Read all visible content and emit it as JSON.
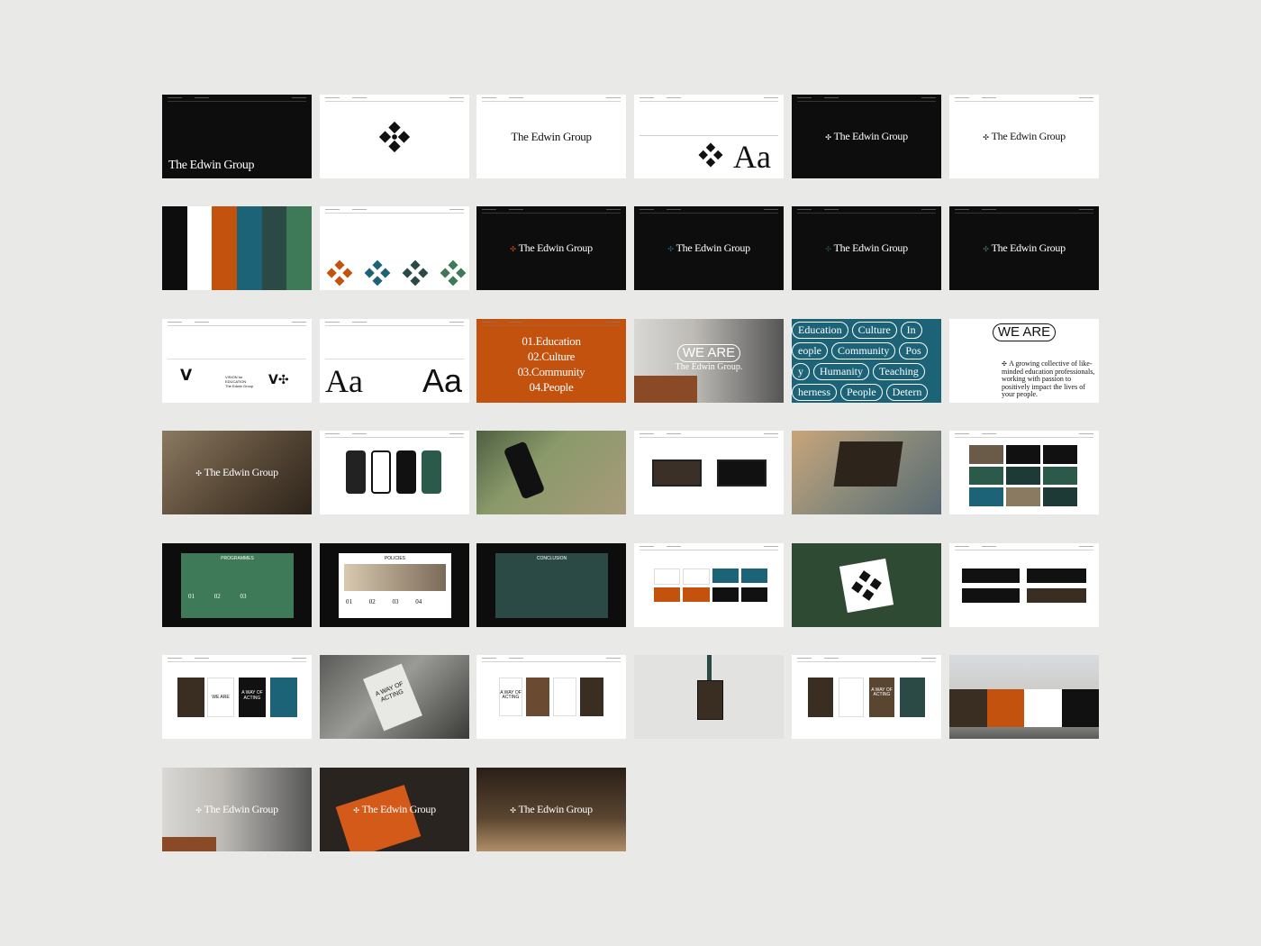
{
  "brand": {
    "name": "The Edwin Group",
    "name_alt": "The Edwin Group.",
    "sub_name": "The Edwin Group",
    "aa": "Aa",
    "colors": {
      "black": "#0d0d0d",
      "white": "#ffffff",
      "orange": "#c4520f",
      "blue": "#1d6378",
      "dark_teal": "#2b4a46",
      "green": "#3e7a57"
    },
    "mark_icon": "quatrefoil-mark-icon"
  },
  "agenda": {
    "item1": "01.Education",
    "item2": "02.Culture",
    "item3": "03.Community",
    "item4": "04.People"
  },
  "we_are": {
    "title": "WE ARE",
    "subtitle": "The Edwin Group.",
    "body": "A growing collective of like-minded education professionals, working with passion to positively impact the lives of your people."
  },
  "values": {
    "row1": [
      "Education",
      "Culture",
      "In"
    ],
    "row2": [
      "eople",
      "Community",
      "Pos"
    ],
    "row3": [
      "y",
      "Humanity",
      "Teaching"
    ],
    "row4": [
      "herness",
      "People",
      "Detern"
    ]
  },
  "campaign": {
    "headline": "A WAY OF ACTING",
    "we_are_short": "WE ARE",
    "we_are_poster": "We are The Edwin Group."
  },
  "sections": {
    "programmes": "PROGRAMMES",
    "policies": "POLICIES",
    "conclusion": "CONCLUSION",
    "n1": "01",
    "n2": "02",
    "n3": "03",
    "n4": "04"
  },
  "logo_lockup": {
    "vision": "VISION for EDUCATION"
  }
}
